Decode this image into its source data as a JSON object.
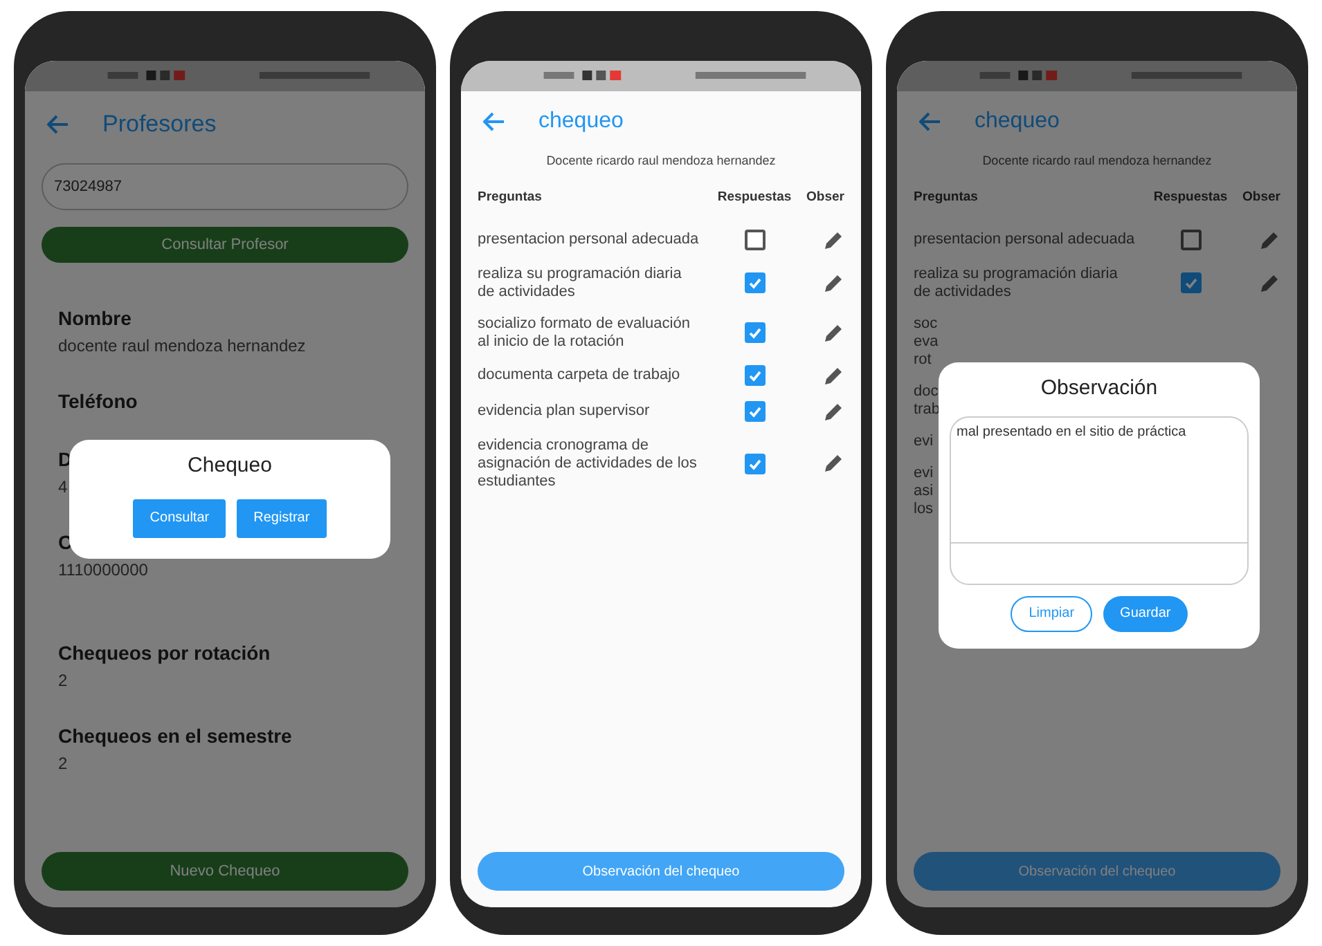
{
  "phones": [
    {
      "kind": "profile",
      "title": "Profesores",
      "search_value": "73024987",
      "search_button": "Consultar Profesor",
      "fields": [
        {
          "label": "Nombre",
          "value": "docente raul mendoza hernandez"
        },
        {
          "label": "Teléfono"
        },
        {
          "label": "D",
          "value": "4"
        },
        {
          "label": "C",
          "value": "1110000000"
        },
        {
          "label": "Chequeos por rotación",
          "value": "2"
        },
        {
          "label": "Chequeos en el semestre",
          "value": "2"
        }
      ],
      "bottom_button": "Nuevo Chequeo",
      "dialog": {
        "kind": "choice",
        "title": "Chequeo",
        "buttons": [
          "Consultar",
          "Registrar"
        ]
      }
    },
    {
      "kind": "checklist",
      "title": "chequeo",
      "subtitle": "Docente ricardo raul mendoza hernandez",
      "columns": [
        "Preguntas",
        "Respuestas",
        "Obser"
      ],
      "rows": [
        {
          "kind": "full",
          "text": "presentacion personal adecuada",
          "checked": false
        },
        {
          "kind": "full",
          "text": "realiza su programación diaria de actividades",
          "checked": true
        },
        {
          "kind": "full",
          "text": "socializo formato de evaluación al inicio de la rotación",
          "checked": true
        },
        {
          "kind": "full",
          "text": "documenta carpeta de trabajo",
          "checked": true
        },
        {
          "kind": "full",
          "text": "evidencia plan supervisor",
          "checked": true
        },
        {
          "kind": "full",
          "text": "evidencia cronograma de asignación de actividades de los estudiantes",
          "checked": true
        }
      ],
      "bottom_button": "Observación del chequeo"
    },
    {
      "kind": "checklist",
      "title": "chequeo",
      "subtitle": "Docente ricardo raul mendoza hernandez",
      "columns": [
        "Preguntas",
        "Respuestas",
        "Obser"
      ],
      "rows": [
        {
          "kind": "full",
          "text": "presentacion personal adecuada",
          "checked": false
        },
        {
          "kind": "full",
          "text": "realiza su programación diaria de actividades",
          "checked": true
        },
        {
          "kind": "covered",
          "lines": [
            "soc",
            "eva",
            "rot"
          ]
        },
        {
          "kind": "covered",
          "lines": [
            "doc",
            "trab"
          ]
        },
        {
          "kind": "covered",
          "lines": [
            "evi"
          ]
        },
        {
          "kind": "covered",
          "lines": [
            "evi",
            "asi",
            "los"
          ]
        }
      ],
      "bottom_button": "Observación del chequeo",
      "dialog": {
        "kind": "note",
        "title": "Observación",
        "value": "mal presentado en el sitio de práctica",
        "buttons": [
          "Limpiar",
          "Guardar"
        ]
      }
    }
  ]
}
